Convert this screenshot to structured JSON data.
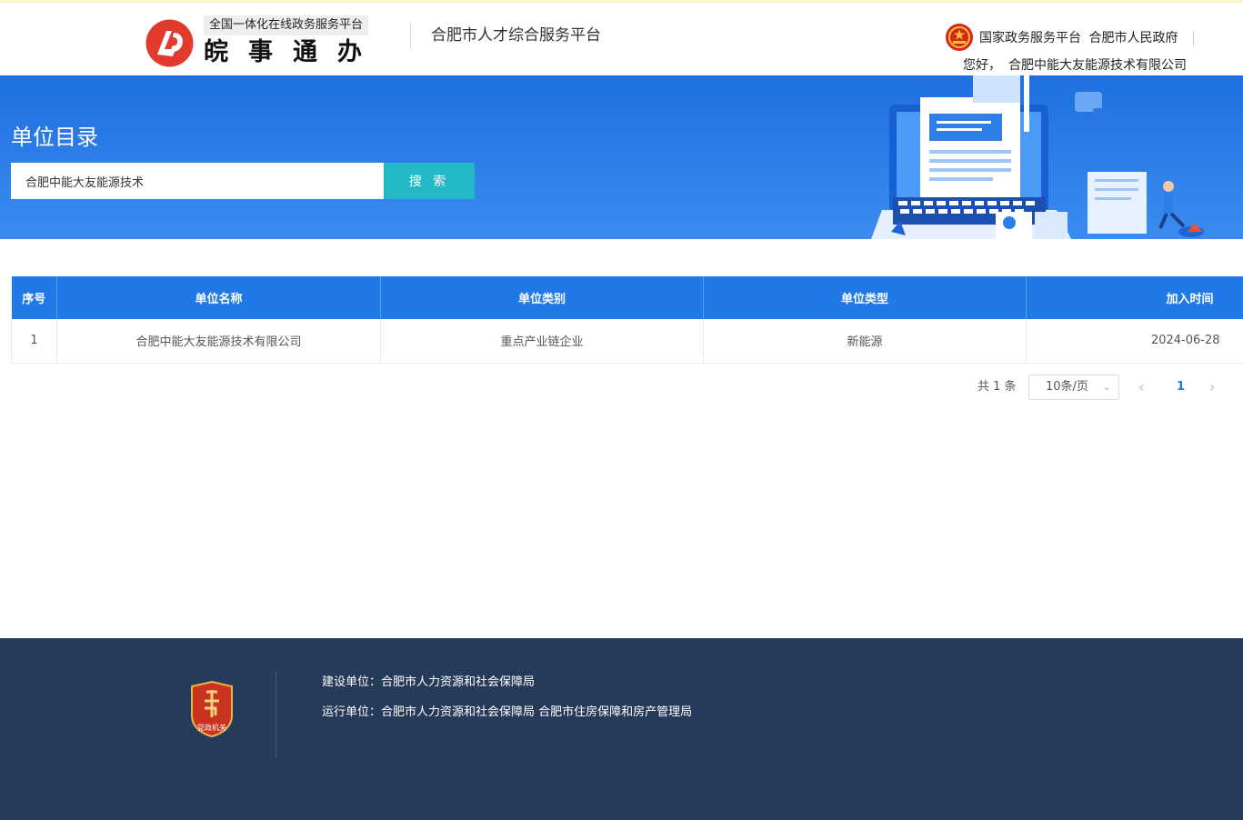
{
  "header": {
    "logo_tagline": "全国一体化在线政务服务平台",
    "logo_name": "皖事通办",
    "platform_title": "合肥市人才综合服务平台",
    "top_links": [
      "国家政务服务平台",
      "合肥市人民政府"
    ],
    "greeting": "您好，",
    "company": "合肥中能大友能源技术有限公司"
  },
  "banner": {
    "title": "单位目录",
    "search_value": "合肥中能大友能源技术",
    "search_button": "搜 索"
  },
  "table": {
    "columns": [
      "序号",
      "单位名称",
      "单位类别",
      "单位类型",
      "加入时间"
    ],
    "rows": [
      [
        "1",
        "合肥中能大友能源技术有限公司",
        "重点产业链企业",
        "新能源",
        "2024-06-28"
      ]
    ]
  },
  "pagination": {
    "total": "共 1 条",
    "page_size": "10条/页",
    "current_page": "1"
  },
  "footer": {
    "badge_text": "党政机关",
    "builder": "建设单位：合肥市人力资源和社会保障局",
    "operator": "运行单位：合肥市人力资源和社会保障局 合肥市住房保障和房产管理局"
  },
  "colors": {
    "primary": "#1f7ae8",
    "search_button": "#22b8c6",
    "footer_bg": "#263a59",
    "logo_red": "#e23b2e"
  }
}
